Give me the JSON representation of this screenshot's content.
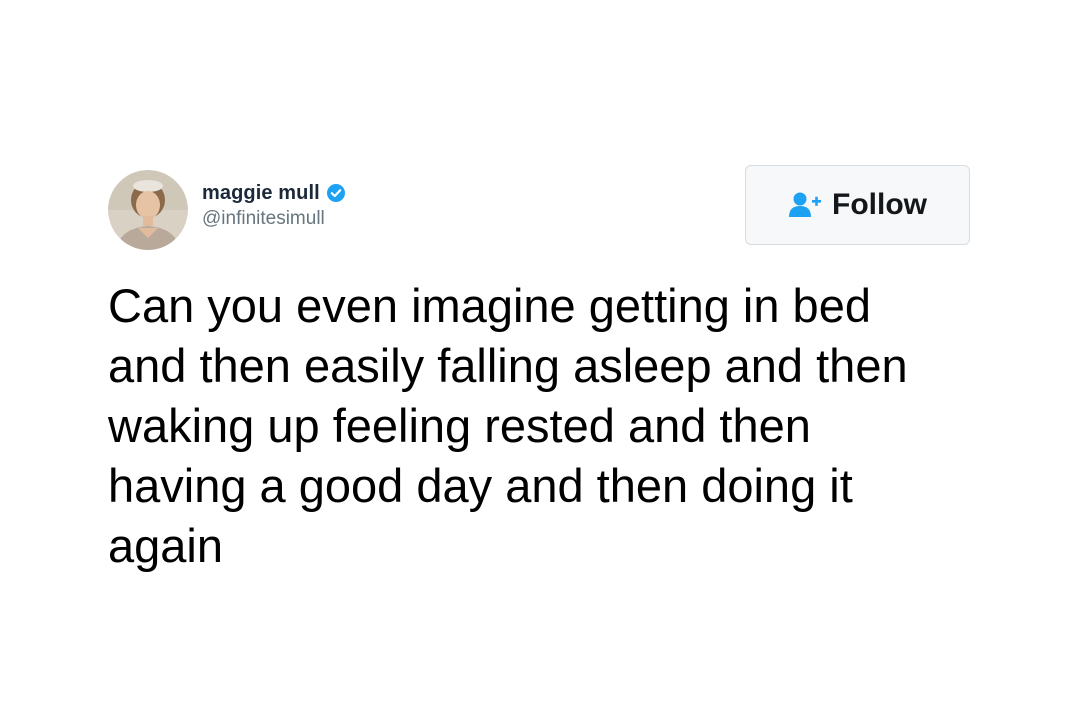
{
  "tweet": {
    "author": {
      "display_name": "maggie mull",
      "handle": "@infinitesimull",
      "verified": true,
      "avatar_icon": "profile-photo"
    },
    "follow_button": {
      "label": "Follow",
      "icon": "add-user-icon"
    },
    "text": "Can you even imagine getting in bed\nand then easily falling asleep and then\nwaking up feeling rested and then\nhaving a good day and then doing it\nagain"
  },
  "colors": {
    "verified_blue": "#1da1f2",
    "follow_icon_blue": "#1da1f2",
    "handle_gray": "#66757f",
    "button_border": "#d6dde3"
  }
}
